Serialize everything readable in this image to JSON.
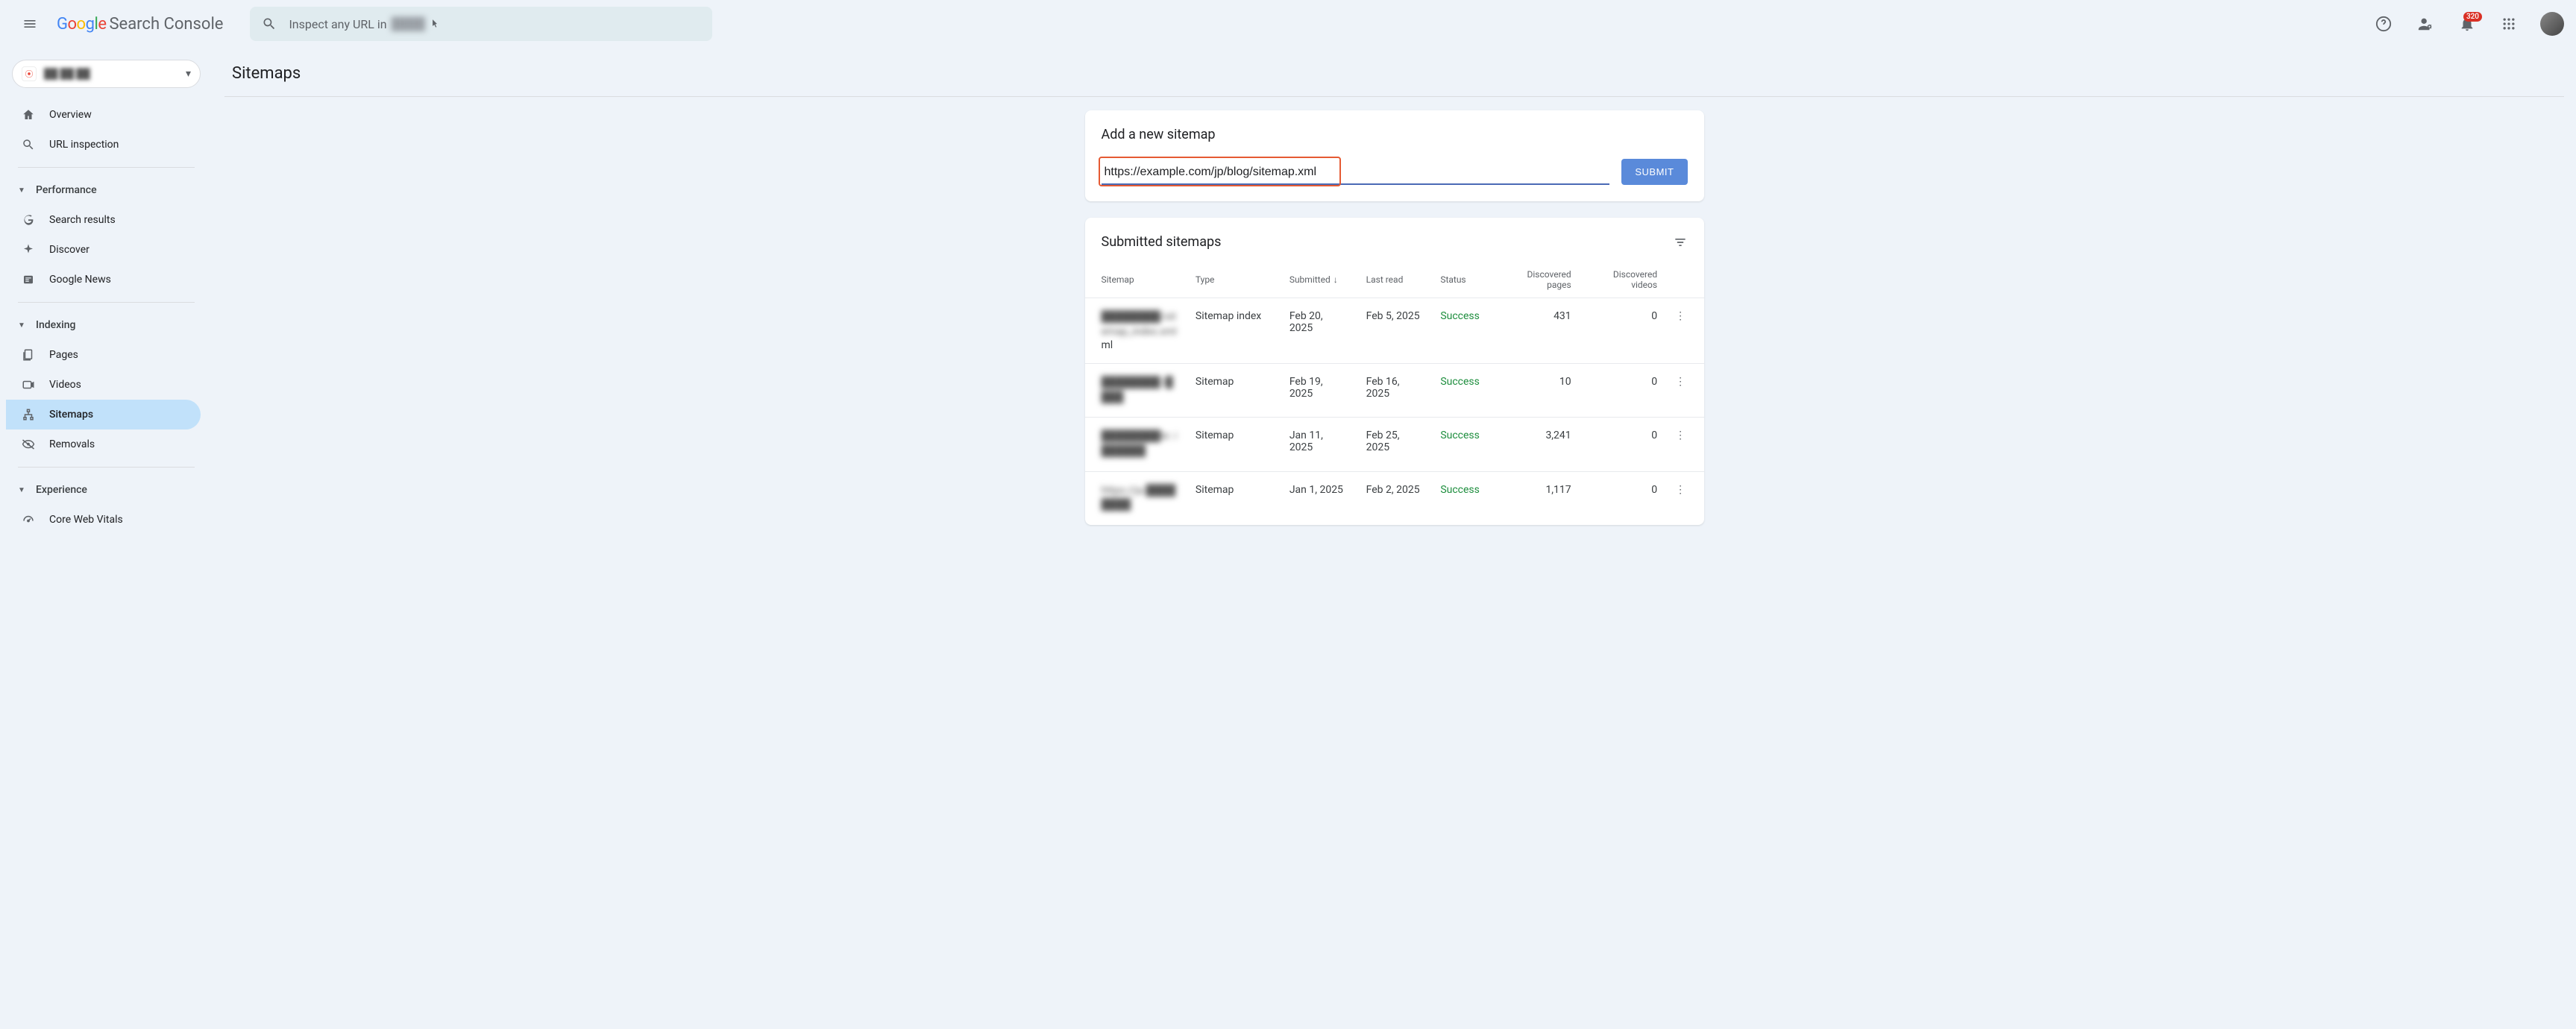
{
  "app": {
    "brand_parts": [
      "G",
      "o",
      "o",
      "g",
      "l",
      "e"
    ],
    "product": "Search Console"
  },
  "search": {
    "prefix": "Inspect any URL in",
    "domain_blurred": "████"
  },
  "notifications": {
    "count": "320"
  },
  "property": {
    "name_blurred": "██ ██ ██"
  },
  "sidebar": {
    "overview": "Overview",
    "url_inspection": "URL inspection",
    "group_performance": "Performance",
    "search_results": "Search results",
    "discover": "Discover",
    "google_news": "Google News",
    "group_indexing": "Indexing",
    "pages": "Pages",
    "videos": "Videos",
    "sitemaps": "Sitemaps",
    "removals": "Removals",
    "group_experience": "Experience",
    "core_web_vitals": "Core Web Vitals"
  },
  "page": {
    "title": "Sitemaps"
  },
  "add": {
    "title": "Add a new sitemap",
    "input_value": "https://example.com/jp/blog/sitemap.xml",
    "submit": "SUBMIT"
  },
  "submitted": {
    "title": "Submitted sitemaps",
    "columns": {
      "sitemap": "Sitemap",
      "type": "Type",
      "submitted": "Submitted",
      "last_read": "Last read",
      "status": "Status",
      "pages": "Discovered pages",
      "videos": "Discovered videos"
    },
    "rows": [
      {
        "url": "████████/sitemap_index.xml",
        "url_suffix": "ml",
        "type": "Sitemap index",
        "submitted": "Feb 20, 2025",
        "last_read": "Feb 5, 2025",
        "status": "Success",
        "pages": "431",
        "videos": "0"
      },
      {
        "url": "████████ i████",
        "type": "Sitemap",
        "submitted": "Feb 19, 2025",
        "last_read": "Feb 16, 2025",
        "status": "Success",
        "pages": "10",
        "videos": "0"
      },
      {
        "url": "████████br. i██████",
        "type": "Sitemap",
        "submitted": "Jan 11, 2025",
        "last_read": "Feb 25, 2025",
        "status": "Success",
        "pages": "3,241",
        "videos": "0"
      },
      {
        "url": "https://ja.████████",
        "type": "Sitemap",
        "submitted": "Jan 1, 2025",
        "last_read": "Feb 2, 2025",
        "status": "Success",
        "pages": "1,117",
        "videos": "0"
      }
    ]
  }
}
